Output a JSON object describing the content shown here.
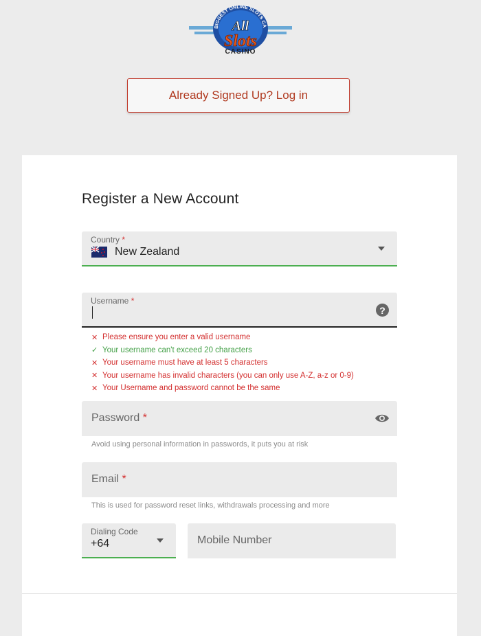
{
  "logo": {
    "arc_text": "BIGGEST ONLINE SLOTS CASINO",
    "word_all": "All",
    "word_slots": "Slots",
    "word_casino": "CASINO"
  },
  "login_button": {
    "label": "Already Signed Up? Log in"
  },
  "form": {
    "title": "Register a New Account",
    "country": {
      "label": "Country",
      "required_mark": "*",
      "value": "New Zealand"
    },
    "username": {
      "label": "Username",
      "required_mark": "*",
      "validations": [
        {
          "status": "error",
          "text": "Please ensure you enter a valid username"
        },
        {
          "status": "ok",
          "text": "Your username can't exceed 20 characters"
        },
        {
          "status": "error",
          "text": "Your username must have at least 5 characters"
        },
        {
          "status": "error",
          "text": "Your username has invalid characters (you can only use A-Z, a-z or 0-9)"
        },
        {
          "status": "error",
          "text": "Your Username and password cannot be the same"
        }
      ]
    },
    "password": {
      "label": "Password",
      "required_mark": "*",
      "hint": "Avoid using personal information in passwords, it puts you at risk"
    },
    "email": {
      "label": "Email",
      "required_mark": "*",
      "hint": "This is used for password reset links, withdrawals processing and more"
    },
    "dialing_code": {
      "label": "Dialing Code",
      "value": "+64"
    },
    "mobile": {
      "placeholder": "Mobile Number"
    }
  },
  "icons": {
    "help": "help-circle-icon",
    "visibility": "eye-icon",
    "dropdown": "chevron-down-icon",
    "error": "x-icon",
    "ok": "check-icon"
  },
  "colors": {
    "accent_red": "#b0391f",
    "error_red": "#d32f2f",
    "success_green": "#43a047",
    "field_bg": "#ebebeb"
  }
}
